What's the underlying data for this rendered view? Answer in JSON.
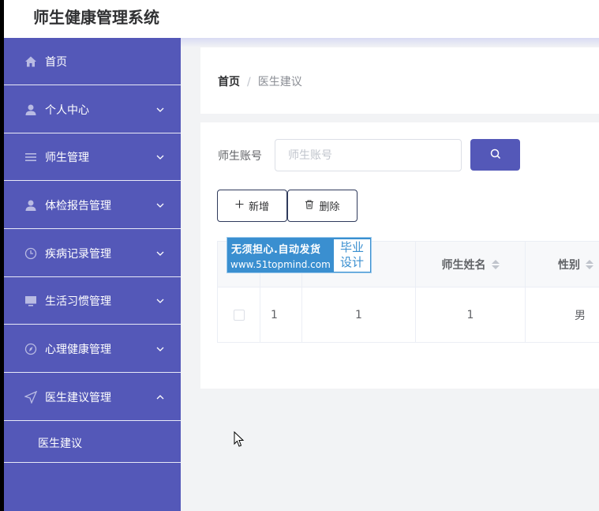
{
  "app": {
    "title": "师生健康管理系统"
  },
  "sidebar": {
    "items": [
      {
        "label": "首页",
        "icon": "home-icon",
        "expandable": false
      },
      {
        "label": "个人中心",
        "icon": "user-icon",
        "expandable": true
      },
      {
        "label": "师生管理",
        "icon": "list-icon",
        "expandable": true
      },
      {
        "label": "体检报告管理",
        "icon": "user-icon",
        "expandable": true
      },
      {
        "label": "疾病记录管理",
        "icon": "clock-icon",
        "expandable": true
      },
      {
        "label": "生活习惯管理",
        "icon": "monitor-icon",
        "expandable": true
      },
      {
        "label": "心理健康管理",
        "icon": "compass-icon",
        "expandable": true
      },
      {
        "label": "医生建议管理",
        "icon": "send-icon",
        "expandable": true,
        "expanded": true
      }
    ],
    "subitems": [
      {
        "label": "医生建议"
      }
    ]
  },
  "breadcrumb": {
    "home": "首页",
    "separator": "/",
    "current": "医生建议"
  },
  "search": {
    "label": "师生账号",
    "placeholder": "师生账号",
    "value": ""
  },
  "actions": {
    "add_label": "新增",
    "delete_label": "删除"
  },
  "table": {
    "columns": [
      "",
      "",
      "",
      "师生姓名",
      "性别"
    ],
    "rows": [
      [
        "",
        "1",
        "1",
        "1",
        "男"
      ]
    ]
  },
  "watermark": {
    "line1": "无须担心.自动发货",
    "line2": "www.51topmind.com",
    "badge_line1": "毕业",
    "badge_line2": "设计"
  },
  "colors": {
    "accent": "#5458b8",
    "watermark": "#3a8fd0"
  }
}
